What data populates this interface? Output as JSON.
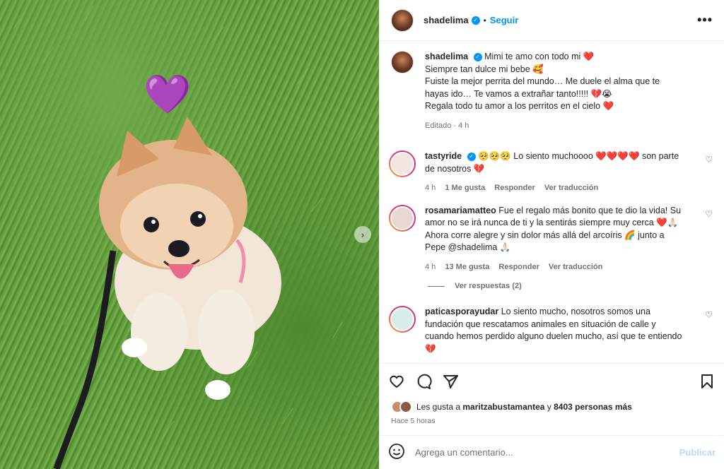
{
  "post": {
    "username": "shadelima",
    "follow_label": "Seguir",
    "more_label": "•••",
    "dot": "•"
  },
  "caption": {
    "username": "shadelima",
    "lines": [
      "Mimi te amo con todo mi ❤️",
      "Siempre tan dulce mi bebe 🥰",
      "Fuiste la mejor perrita del mundo… Me duele el alma que te hayas ido… Te vamos a extrañar tanto!!!!! 💔😭",
      "Regala todo tu amor a los perritos en el cielo ❤️"
    ],
    "edited": "Editado · 4 h"
  },
  "comments": [
    {
      "username": "tastyride",
      "verified": true,
      "text": "🥺🥺🥺 Lo siento muchoooo ❤️❤️❤️❤️ son parte de nosotros 💔",
      "time": "4 h",
      "likes": "1 Me gusta",
      "reply": "Responder",
      "translate": "Ver traducción"
    },
    {
      "username": "rosamariamatteo",
      "verified": false,
      "text": "Fue el regalo más bonito que te dio la vida! Su amor no se irá nunca de ti y la sentirás siempre muy cerca ❤️🙏🏻 Ahora corre alegre y sin dolor más allá del arcoíris 🌈 junto a Pepe @shadelima 🙏🏻",
      "time": "4 h",
      "likes": "13 Me gusta",
      "reply": "Responder",
      "translate": "Ver traducción",
      "view_replies": "Ver respuestas (2)"
    },
    {
      "username": "paticasporayudar",
      "verified": false,
      "text": "Lo siento mucho, nosotros somos una fundación que rescatamos animales en situación de calle y cuando hemos perdido alguno duelen mucho, así que te entiendo 💔"
    }
  ],
  "likes": {
    "prefix": "Les gusta a",
    "user": "maritzabustamantea",
    "connector": "y",
    "others": "8403 personas más"
  },
  "posted": "Hace 5 horas",
  "add_comment": {
    "placeholder": "Agrega un comentario...",
    "post_label": "Publicar"
  },
  "photo": {
    "sticker": "💜",
    "next": "›"
  },
  "colors": {
    "accent": "#0095f6",
    "text": "#262626",
    "muted": "#737373"
  }
}
